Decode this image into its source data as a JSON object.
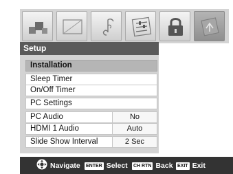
{
  "icons": [
    {
      "name": "picture-icon"
    },
    {
      "name": "frame-icon"
    },
    {
      "name": "music-note-icon"
    },
    {
      "name": "settings-sliders-icon"
    },
    {
      "name": "lock-icon"
    },
    {
      "name": "setup-icon"
    }
  ],
  "menu": {
    "title": "Setup",
    "items": [
      {
        "label": "Installation",
        "value": ""
      },
      {
        "label": "Sleep Timer",
        "value": ""
      },
      {
        "label": "On/Off Timer",
        "value": ""
      },
      {
        "label": "PC Settings",
        "value": ""
      },
      {
        "label": "PC Audio",
        "value": "No"
      },
      {
        "label": "HDMI 1 Audio",
        "value": "Auto"
      },
      {
        "label": "Slide Show Interval",
        "value": "2 Sec"
      }
    ],
    "selected_index": 0
  },
  "help": {
    "navigate_label": "Navigate",
    "enter_key": "ENTER",
    "select_label": "Select",
    "back_key": "CH RTN",
    "back_label": "Back",
    "exit_key": "EXIT",
    "exit_label": "Exit"
  },
  "colors": {
    "title_strip": "#5a5a5a",
    "panel_bg": "#d3d3d3",
    "selected_row": "#b5b5b5",
    "help_bar": "#333333"
  }
}
